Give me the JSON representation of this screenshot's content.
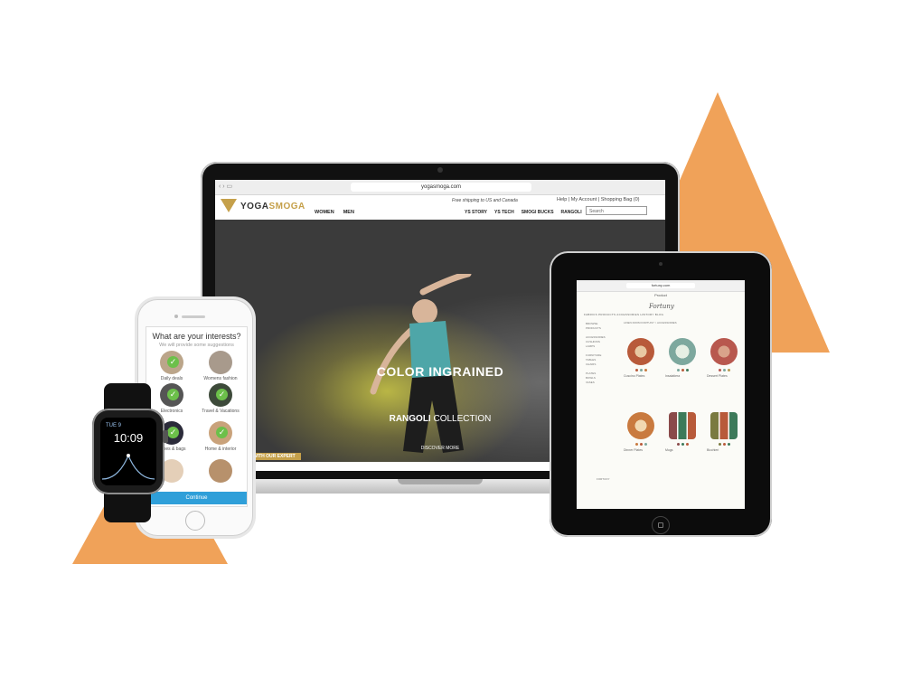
{
  "colors": {
    "accent_orange": "#f0a259",
    "gold": "#c5a04a",
    "continue_blue": "#2f9fd9",
    "check_green": "#6cc04a"
  },
  "laptop": {
    "url": "yogasmoga.com",
    "shipping_note": "Free shipping to US and Canada",
    "top_links": "Help  |  My Account  |  Shopping Bag (0)",
    "logo_part1": "YOGA",
    "logo_part2": "SMOGA",
    "main_nav": [
      "WOMEN",
      "MEN"
    ],
    "right_nav": [
      "YS STORY",
      "YS TECH",
      "SMOGI BUCKS",
      "RANGOLI"
    ],
    "search_placeholder": "Search",
    "hero_title": "COLOR INGRAINED",
    "hero_sub_bold": "RANGOLI",
    "hero_sub_rest": " COLLECTION",
    "hero_cta": "DISCOVER MORE",
    "expert_banner": "WITH OUR EXPERT"
  },
  "tablet": {
    "url": "fortuny.com",
    "tab_title": "Product",
    "logo": "Fortuny",
    "menu": "FABRICS   PRODUCTS   ACCESSORIES   HISTORY   BLOG",
    "heading": "LINEN FROM FORTUNY > ACCESSORIES",
    "sidebar": [
      "BROWSE",
      "PRODUCTS",
      "",
      "ACCESSORIES",
      "CUSHIONS",
      "LAMPS",
      "",
      "FURNITURE",
      "TABLES",
      "CHAIRS",
      "",
      "PLATES",
      "BOWLS",
      "VASES"
    ],
    "products": [
      {
        "name": "Cuscino Plates",
        "color": "#b85a3a"
      },
      {
        "name": "Insalatiera",
        "color": "#7da89e"
      },
      {
        "name": "Dessert Plates",
        "color": "#b8584e"
      },
      {
        "name": "Dinner Plates",
        "color": "#c97a3f"
      },
      {
        "name": "Mugs",
        "color": "#8a4a4a"
      },
      {
        "name": "Bicchieri",
        "color": "#7a7a40"
      }
    ],
    "footer": "FORTUNY"
  },
  "phone": {
    "title": "What are your interests?",
    "subtitle": "We will provide some suggestions",
    "items": [
      {
        "label": "Daily deals",
        "checked": true,
        "color": "#bba58a"
      },
      {
        "label": "Womens fashion",
        "checked": false,
        "color": "#a89a8c"
      },
      {
        "label": "Electronics",
        "checked": true,
        "color": "#555555"
      },
      {
        "label": "Travel & Vacations",
        "checked": true,
        "color": "#3d4a3a"
      },
      {
        "label": "Shoes & bags",
        "checked": true,
        "color": "#2b2b3a"
      },
      {
        "label": "Home & interior",
        "checked": true,
        "color": "#c9a27b"
      }
    ],
    "continue_label": "Continue"
  },
  "watch": {
    "date": "TUE 9",
    "time": "10:09"
  }
}
